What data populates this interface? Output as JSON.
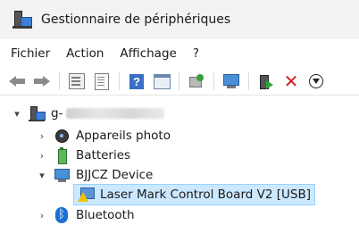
{
  "window": {
    "title": "Gestionnaire de périphériques",
    "app_icon": "device-manager-icon"
  },
  "menu": [
    "Fichier",
    "Action",
    "Affichage",
    "?"
  ],
  "toolbar": {
    "icons": [
      "back-arrow-icon",
      "forward-arrow-icon",
      "properties-icon",
      "show-hidden-icon",
      "help-icon",
      "panel-icon",
      "update-driver-icon",
      "scan-hardware-icon",
      "enable-device-icon",
      "uninstall-icon",
      "download-icon"
    ]
  },
  "tree": {
    "root": {
      "label": "g-",
      "expanded": true,
      "icon": "computer-icon"
    },
    "nodes": [
      {
        "label": "Appareils photo",
        "icon": "camera-icon",
        "expanded": false
      },
      {
        "label": "Batteries",
        "icon": "battery-icon",
        "expanded": false
      },
      {
        "label": "BJJCZ Device",
        "icon": "device-icon",
        "expanded": true
      },
      {
        "label": "Laser Mark Control Board V2 [USB]",
        "icon": "warning-device-icon",
        "selected": true
      },
      {
        "label": "Bluetooth",
        "icon": "bluetooth-icon",
        "expanded": false
      }
    ]
  },
  "colors": {
    "selection_bg": "#cce8ff",
    "selection_border": "#99d1ff",
    "warning": "#f2c200",
    "uninstall": "#d21f1f"
  }
}
